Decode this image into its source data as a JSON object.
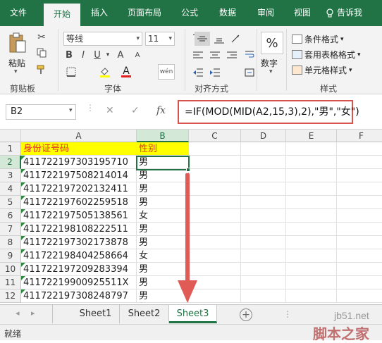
{
  "ribbon_tabs": [
    "文件",
    "开始",
    "插入",
    "页面布局",
    "公式",
    "数据",
    "审阅",
    "视图"
  ],
  "tell_me": "告诉我",
  "clipboard": {
    "paste": "粘贴",
    "group": "剪贴板"
  },
  "font": {
    "name": "等线",
    "size": "11",
    "group": "字体",
    "bold": "B",
    "italic": "I",
    "underline": "U",
    "grow": "A",
    "shrink": "A",
    "color_letter": "A",
    "phonetic": "wén"
  },
  "alignment": {
    "group": "对齐方式"
  },
  "number": {
    "format": "数字",
    "symbol": "%"
  },
  "styles": {
    "conditional": "条件格式",
    "table": "套用表格格式",
    "cell": "单元格样式",
    "group": "样式"
  },
  "formula_bar": {
    "name_box": "B2",
    "cancel": "✕",
    "confirm": "✓",
    "fx": "fx",
    "formula": "=IF(MOD(MID(A2,15,3),2),\"男\",\"女\")"
  },
  "columns": [
    "A",
    "B",
    "C",
    "D",
    "E",
    "F"
  ],
  "rows": [
    {
      "n": "1",
      "a": "身份证号码",
      "b": "性别"
    },
    {
      "n": "2",
      "a": "411722197303195710",
      "b": "男"
    },
    {
      "n": "3",
      "a": "411722197508214014",
      "b": "男"
    },
    {
      "n": "4",
      "a": "411722197202132411",
      "b": "男"
    },
    {
      "n": "5",
      "a": "411722197602259518",
      "b": "男"
    },
    {
      "n": "6",
      "a": "411722197505138561",
      "b": "女"
    },
    {
      "n": "7",
      "a": "411722198108222511",
      "b": "男"
    },
    {
      "n": "8",
      "a": "411722197302173878",
      "b": "男"
    },
    {
      "n": "9",
      "a": "411722198404258664",
      "b": "女"
    },
    {
      "n": "10",
      "a": "411722197209283394",
      "b": "男"
    },
    {
      "n": "11",
      "a": "41172219900925511X",
      "b": "男"
    },
    {
      "n": "12",
      "a": "411722197308248797",
      "b": "男"
    }
  ],
  "sheets": [
    "Sheet1",
    "Sheet2",
    "Sheet3"
  ],
  "status": "就绪",
  "watermark": {
    "site": "jb51.net",
    "name": "脚本之家"
  },
  "colors": {
    "accent": "#217346",
    "highlight": "#ffff00",
    "header_text": "#e03020",
    "callout": "#d9534f"
  }
}
